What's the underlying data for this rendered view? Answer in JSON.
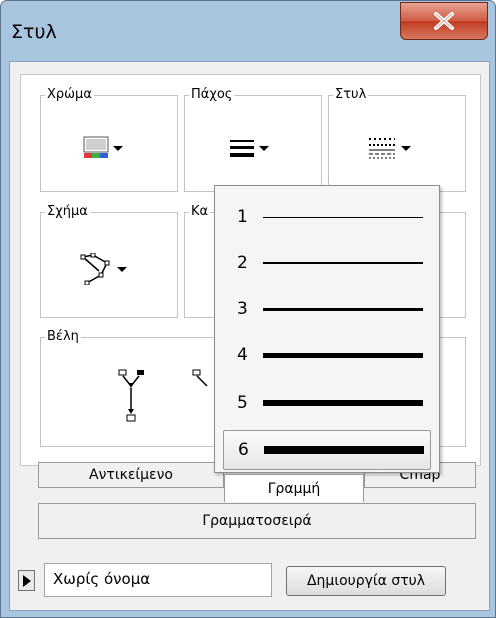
{
  "window": {
    "title": "Στυλ",
    "close_symbol": "X"
  },
  "groups": {
    "color": "Χρώμα",
    "thickness": "Πάχος",
    "style": "Στυλ",
    "shape": "Σχήμα",
    "shape2_partial": "Κα",
    "arrows": "Βέλη"
  },
  "thickness_menu": {
    "items": [
      {
        "label": "1",
        "width": 1
      },
      {
        "label": "2",
        "width": 2
      },
      {
        "label": "3",
        "width": 3
      },
      {
        "label": "4",
        "width": 4
      },
      {
        "label": "5",
        "width": 5
      },
      {
        "label": "6",
        "width": 6
      }
    ],
    "selected": "6"
  },
  "tabs": {
    "object": "Αντικείμενο",
    "line": "Γραμμή",
    "cmap": "Cmap",
    "font": "Γραμματοσειρά"
  },
  "footer": {
    "style_name_value": "Χωρίς όνομα",
    "create_button": "Δημιουργία στυλ"
  },
  "colors": {
    "titlebar": "#a9c4de",
    "close_button": "#c9452b"
  }
}
